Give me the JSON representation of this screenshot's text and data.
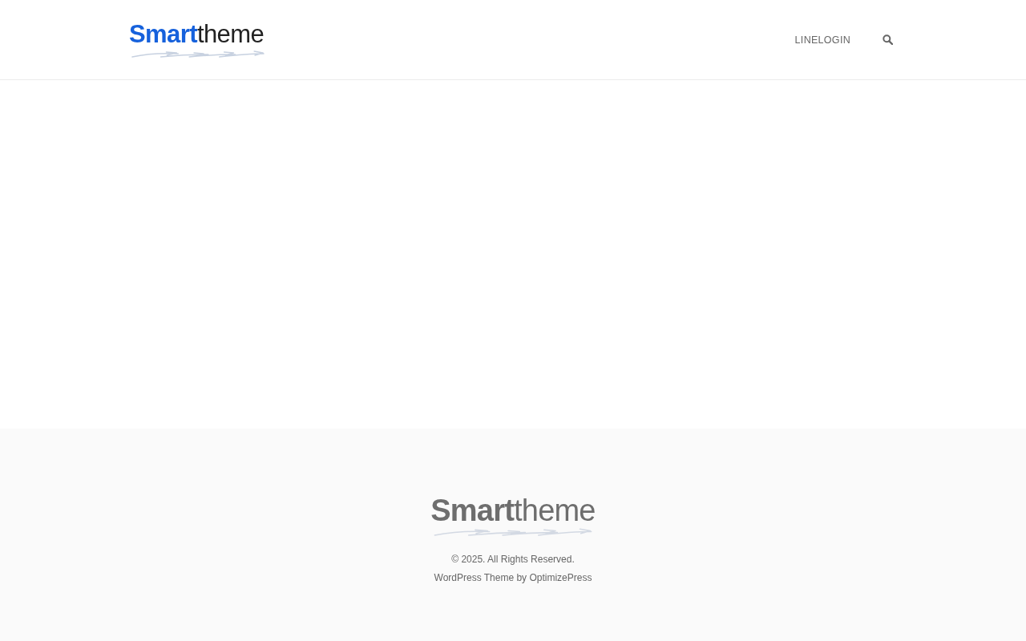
{
  "header": {
    "logo": "**Smart**theme",
    "nav": [
      "LINELOGIN"
    ]
  },
  "footer": {
    "logo": "**Smart**theme",
    "copyright": "© 2025. All Rights Reserved.",
    "credit": "WordPress Theme by OptimizePress"
  }
}
